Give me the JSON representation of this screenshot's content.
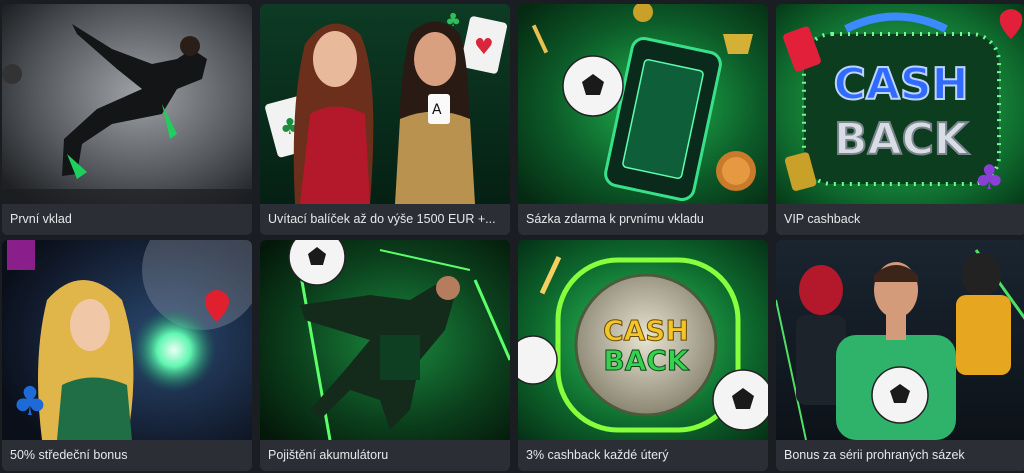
{
  "promos": [
    {
      "title": "První vklad",
      "image": "soccer-player-kick-image"
    },
    {
      "title": "Uvítací balíček až do výše 1500 EUR +...",
      "image": "casino-women-cards-image"
    },
    {
      "title": "Sázka zdarma k prvnímu vkladu",
      "image": "soccer-ball-phone-image"
    },
    {
      "title": "VIP cashback",
      "image": "cashback-neon-sign-image"
    },
    {
      "title": "50% středeční bonus",
      "image": "sorceress-magic-orb-image"
    },
    {
      "title": "Pojištění akumulátoru",
      "image": "soccer-player-green-image"
    },
    {
      "title": "3% cashback každé úterý",
      "image": "cashback-coin-balls-image"
    },
    {
      "title": "Bonus za sérii prohraných sázek",
      "image": "athletes-group-image"
    }
  ],
  "image_text": {
    "cash": "CASH",
    "back": "BACK"
  },
  "colors": {
    "page_bg": "#1a1d22",
    "card_label_bg": "#2b2f35",
    "accent_green": "#22c55e"
  }
}
